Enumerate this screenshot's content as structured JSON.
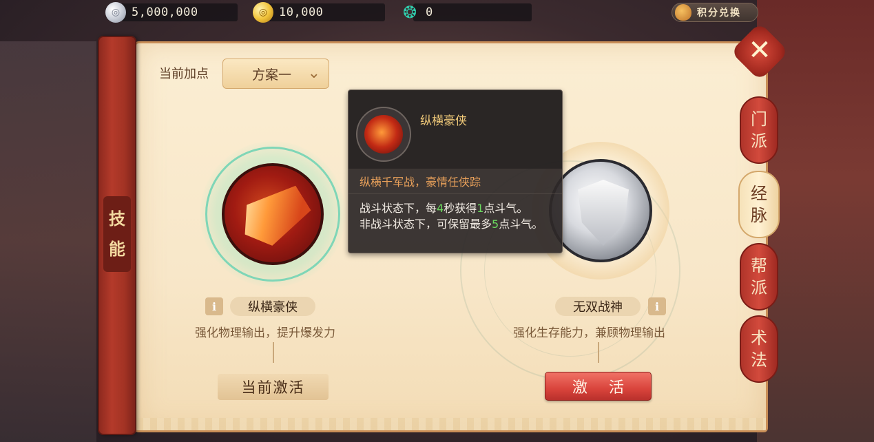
{
  "currency": {
    "silver": "5,000,000",
    "gold": "10,000",
    "jade": "0",
    "exchange_label": "积分兑换"
  },
  "side_banner": {
    "chars": [
      "技",
      "能"
    ]
  },
  "plan": {
    "label": "当前加点",
    "selected": "方案一"
  },
  "skills": {
    "left": {
      "name": "纵横豪侠",
      "description": "强化物理输出，提升爆发力",
      "button": "当前激活"
    },
    "right": {
      "name": "无双战神",
      "description": "强化生存能力，兼顾物理输出",
      "button": "激 活"
    }
  },
  "tooltip": {
    "name": "纵横豪侠",
    "subtitle": "纵横千军战，豪情任侠踪",
    "line1_pre": "战斗状态下，每",
    "line1_num1": "4",
    "line1_mid": "秒获得",
    "line1_num2": "1",
    "line1_post": "点斗气。",
    "line2_pre": "非战斗状态下，可保留最多",
    "line2_num": "5",
    "line2_post": "点斗气。"
  },
  "tabs": [
    {
      "chars": [
        "门",
        "派"
      ],
      "active": false
    },
    {
      "chars": [
        "经",
        "脉"
      ],
      "active": true
    },
    {
      "chars": [
        "帮",
        "派"
      ],
      "active": false
    },
    {
      "chars": [
        "术",
        "法"
      ],
      "active": false
    }
  ],
  "colors": {
    "panel_bg": "#fbeed3",
    "accent_red": "#d9443c",
    "highlight_green": "#6ad95e",
    "tooltip_gold": "#f0c979"
  },
  "icons": [
    "silver-coin-icon",
    "gold-coin-icon",
    "jade-icon",
    "money-bag-icon",
    "close-icon",
    "info-icon",
    "chevron-down-icon"
  ]
}
